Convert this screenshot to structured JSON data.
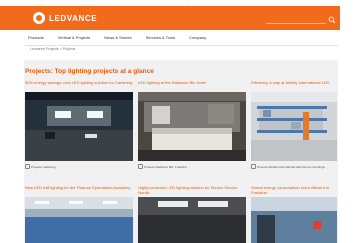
{
  "header": {
    "logo_text": "LEDVANCE",
    "brand_color": "#f26a1b",
    "icons": [
      "search-icon",
      "user-icon",
      "cart-icon"
    ]
  },
  "nav": {
    "items": [
      "Products",
      "Vertical & Projects",
      "News & Stories",
      "Services & Tools",
      "Company"
    ]
  },
  "breadcrumb": "Ledvance Projects > Projects",
  "page_title": "Projects: Top lighting projects at a glance",
  "cards": [
    {
      "title": "50% energy savings: new LED lighting solution for Carlsberg",
      "caption": "Projects Carlsberg"
    },
    {
      "title": "LED lighting at the Radisson Blu Hotel",
      "caption": "Projects Radisson Blu, Frankfurt"
    },
    {
      "title": "Efficiency & way at Mobity International LED",
      "caption": "Projects Mobile International LED Recommendings"
    },
    {
      "title": "New LED hall lighting for the Finance Gymnastics Academy",
      "caption": ""
    },
    {
      "title": "Highly luminous LED lighting solution for Electro Service Nordic",
      "caption": ""
    },
    {
      "title": "Global energy consumption more efficient in Frankfurt",
      "caption": ""
    }
  ]
}
